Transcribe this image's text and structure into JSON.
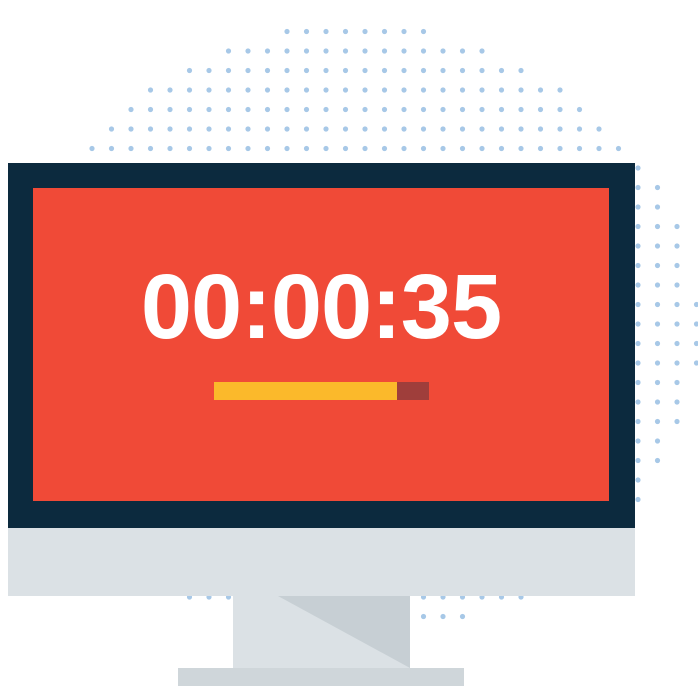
{
  "timer": {
    "display": "00:00:35",
    "progress_percent": 85
  },
  "colors": {
    "dots": "#a7c8e7",
    "bezel": "#0c2a3e",
    "screen": "#f04a37",
    "timer_text": "#ffffff",
    "progress_fill": "#fbb92b",
    "progress_track": "#9f3e3b",
    "monitor_chin": "#dbe1e5",
    "monitor_stand": "#dbe1e5",
    "stand_shadow": "#c7cfd4"
  },
  "icons": {
    "illustration": "desktop-monitor-icon"
  }
}
